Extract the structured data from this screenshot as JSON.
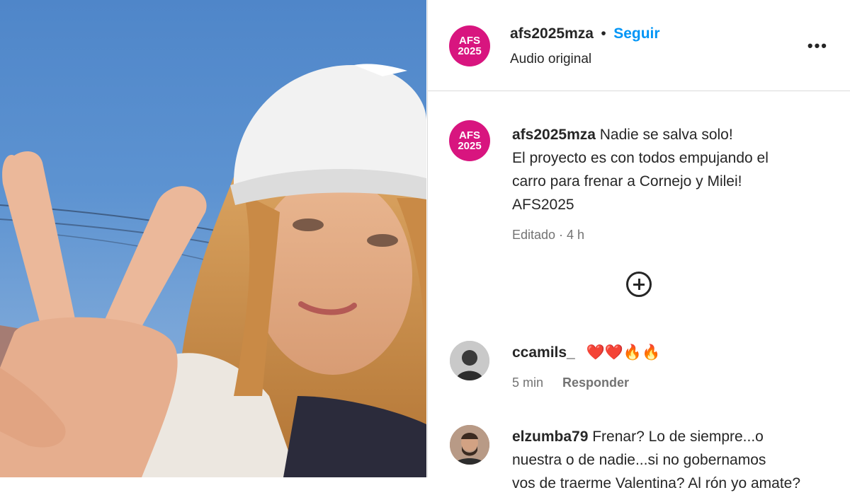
{
  "post": {
    "username": "afs2025mza",
    "follow_label": "Seguir",
    "separator": "•",
    "audio": "Audio original",
    "avatar_text_line1": "AFS",
    "avatar_text_line2": "2025",
    "more_icon": "more-horizontal-icon"
  },
  "caption": {
    "username": "afs2025mza",
    "line1": "Nadie se salva solo!",
    "line2": "El proyecto es con todos empujando el",
    "line3": "carro para frenar a Cornejo y Milei!",
    "line4": "AFS2025",
    "meta": "Editado · 4 h"
  },
  "load_more_icon": "plus-circle-icon",
  "comments": [
    {
      "username": "ccamils_",
      "text": "❤️❤️🔥🔥",
      "time": "5 min",
      "reply": "Responder"
    },
    {
      "username": "elzumba79",
      "line1": "Frenar? Lo de siempre...o",
      "line2": "nuestra o de nadie...si no gobernamos",
      "line3": "vos de traerme Valentina? Al rón yo amate?"
    }
  ],
  "colors": {
    "brand": "#d8157f",
    "follow": "#0095f6",
    "muted": "#737373"
  }
}
